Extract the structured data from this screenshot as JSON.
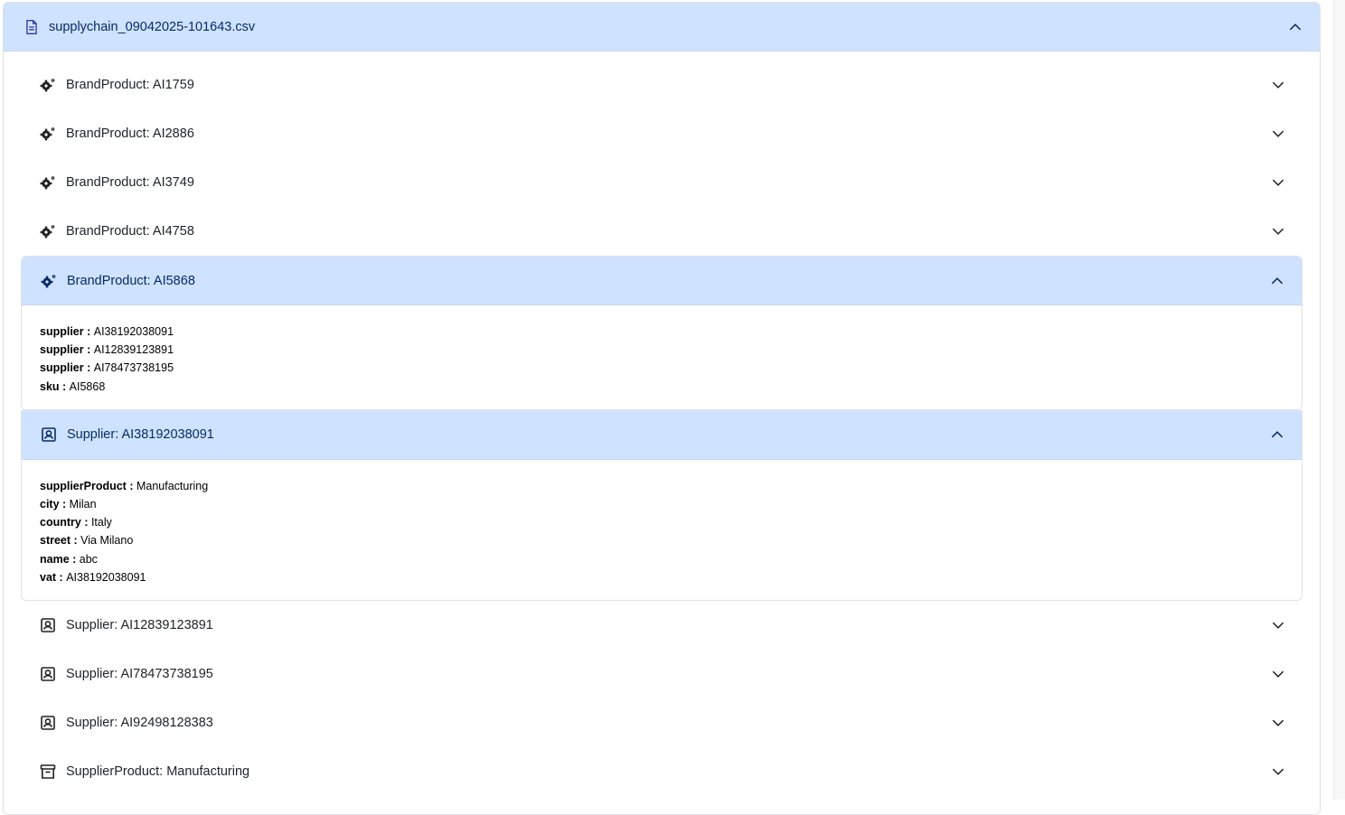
{
  "file": {
    "name": "supplychain_09042025-101643.csv",
    "icon": "file-text-icon"
  },
  "items": [
    {
      "label": "BrandProduct: AI1759",
      "icon": "gears-icon"
    },
    {
      "label": "BrandProduct: AI2886",
      "icon": "gears-icon"
    },
    {
      "label": "BrandProduct: AI3749",
      "icon": "gears-icon"
    },
    {
      "label": "BrandProduct: AI4758",
      "icon": "gears-icon"
    }
  ],
  "open_brand": {
    "label": "BrandProduct: AI5868",
    "icon": "gears-icon",
    "fields": [
      {
        "key": "supplier",
        "sep": " : ",
        "value": "AI38192038091"
      },
      {
        "key": "supplier",
        "sep": " : ",
        "value": "AI12839123891"
      },
      {
        "key": "supplier",
        "sep": " : ",
        "value": "AI78473738195"
      },
      {
        "key": "sku",
        "sep": " : ",
        "value": "AI5868"
      }
    ]
  },
  "open_supplier": {
    "label": "Supplier: AI38192038091",
    "icon": "person-badge-icon",
    "fields": [
      {
        "key": "supplierProduct",
        "sep": " : ",
        "value": "Manufacturing"
      },
      {
        "key": "city",
        "sep": " : ",
        "value": "Milan"
      },
      {
        "key": "country",
        "sep": " : ",
        "value": "Italy"
      },
      {
        "key": "street",
        "sep": " : ",
        "value": "Via Milano"
      },
      {
        "key": "name",
        "sep": " : ",
        "value": "abc"
      },
      {
        "key": "vat",
        "sep": " : ",
        "value": "AI38192038091"
      }
    ]
  },
  "suppliers": [
    {
      "label": "Supplier: AI12839123891",
      "icon": "person-badge-icon"
    },
    {
      "label": "Supplier: AI78473738195",
      "icon": "person-badge-icon"
    },
    {
      "label": "Supplier: AI92498128383",
      "icon": "person-badge-icon"
    }
  ],
  "supplier_product": {
    "label": "SupplierProduct: Manufacturing",
    "icon": "archive-icon"
  },
  "colors": {
    "accent_bg": "#cfe2ff",
    "accent_text": "#052c65"
  }
}
